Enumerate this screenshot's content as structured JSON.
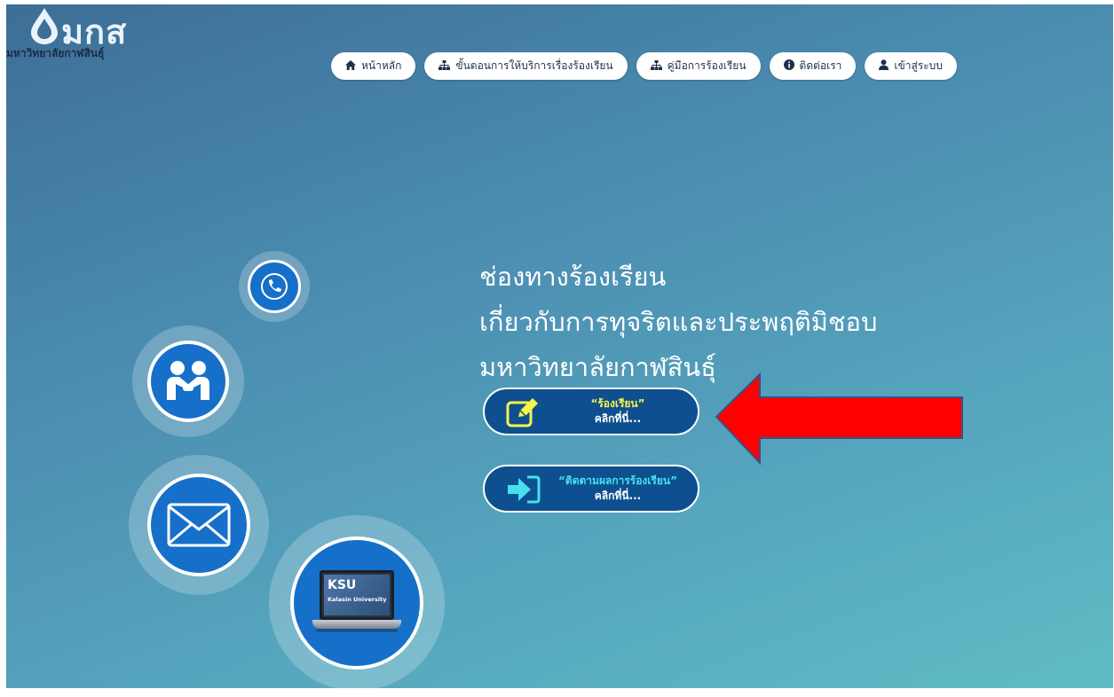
{
  "logo": {
    "mark": "มกส",
    "subtitle": "มหาวิทยาลัยกาฬสินธุ์"
  },
  "nav": {
    "items": [
      {
        "label": "หน้าหลัก",
        "icon": "home-icon"
      },
      {
        "label": "ขั้นตอนการให้บริการเรื่องร้องเรียน",
        "icon": "sitemap-icon"
      },
      {
        "label": "คู่มือการร้องเรียน",
        "icon": "sitemap-icon"
      },
      {
        "label": "ติดต่อเรา",
        "icon": "info-icon"
      },
      {
        "label": "เข้าสู่ระบบ",
        "icon": "user-icon"
      }
    ]
  },
  "heading": {
    "line1": "ช่องทางร้องเรียน",
    "line2": "เกี่ยวกับการทุจริตและประพฤติมิชอบ",
    "line3": "มหาวิทยาลัยกาฬสินธุ์"
  },
  "actions": {
    "complain": {
      "title": "“ร้องเรียน”",
      "cta": "คลิกที่นี่...",
      "icon": "edit-icon"
    },
    "track": {
      "title": "“ติดตามผลการร้องเรียน”",
      "cta": "คลิกที่นี่...",
      "icon": "sign-in-icon"
    }
  },
  "illustration": {
    "laptop_title": "KSU",
    "laptop_subtitle": "Kalasin University",
    "icons": [
      "phone-icon",
      "handshake-icon",
      "mail-icon",
      "laptop-icon"
    ]
  },
  "colors": {
    "accent_yellow": "#f7f34a",
    "accent_cyan": "#46e0f0",
    "button_blue": "#0e4f8f",
    "arrow_red": "#ff0000"
  }
}
